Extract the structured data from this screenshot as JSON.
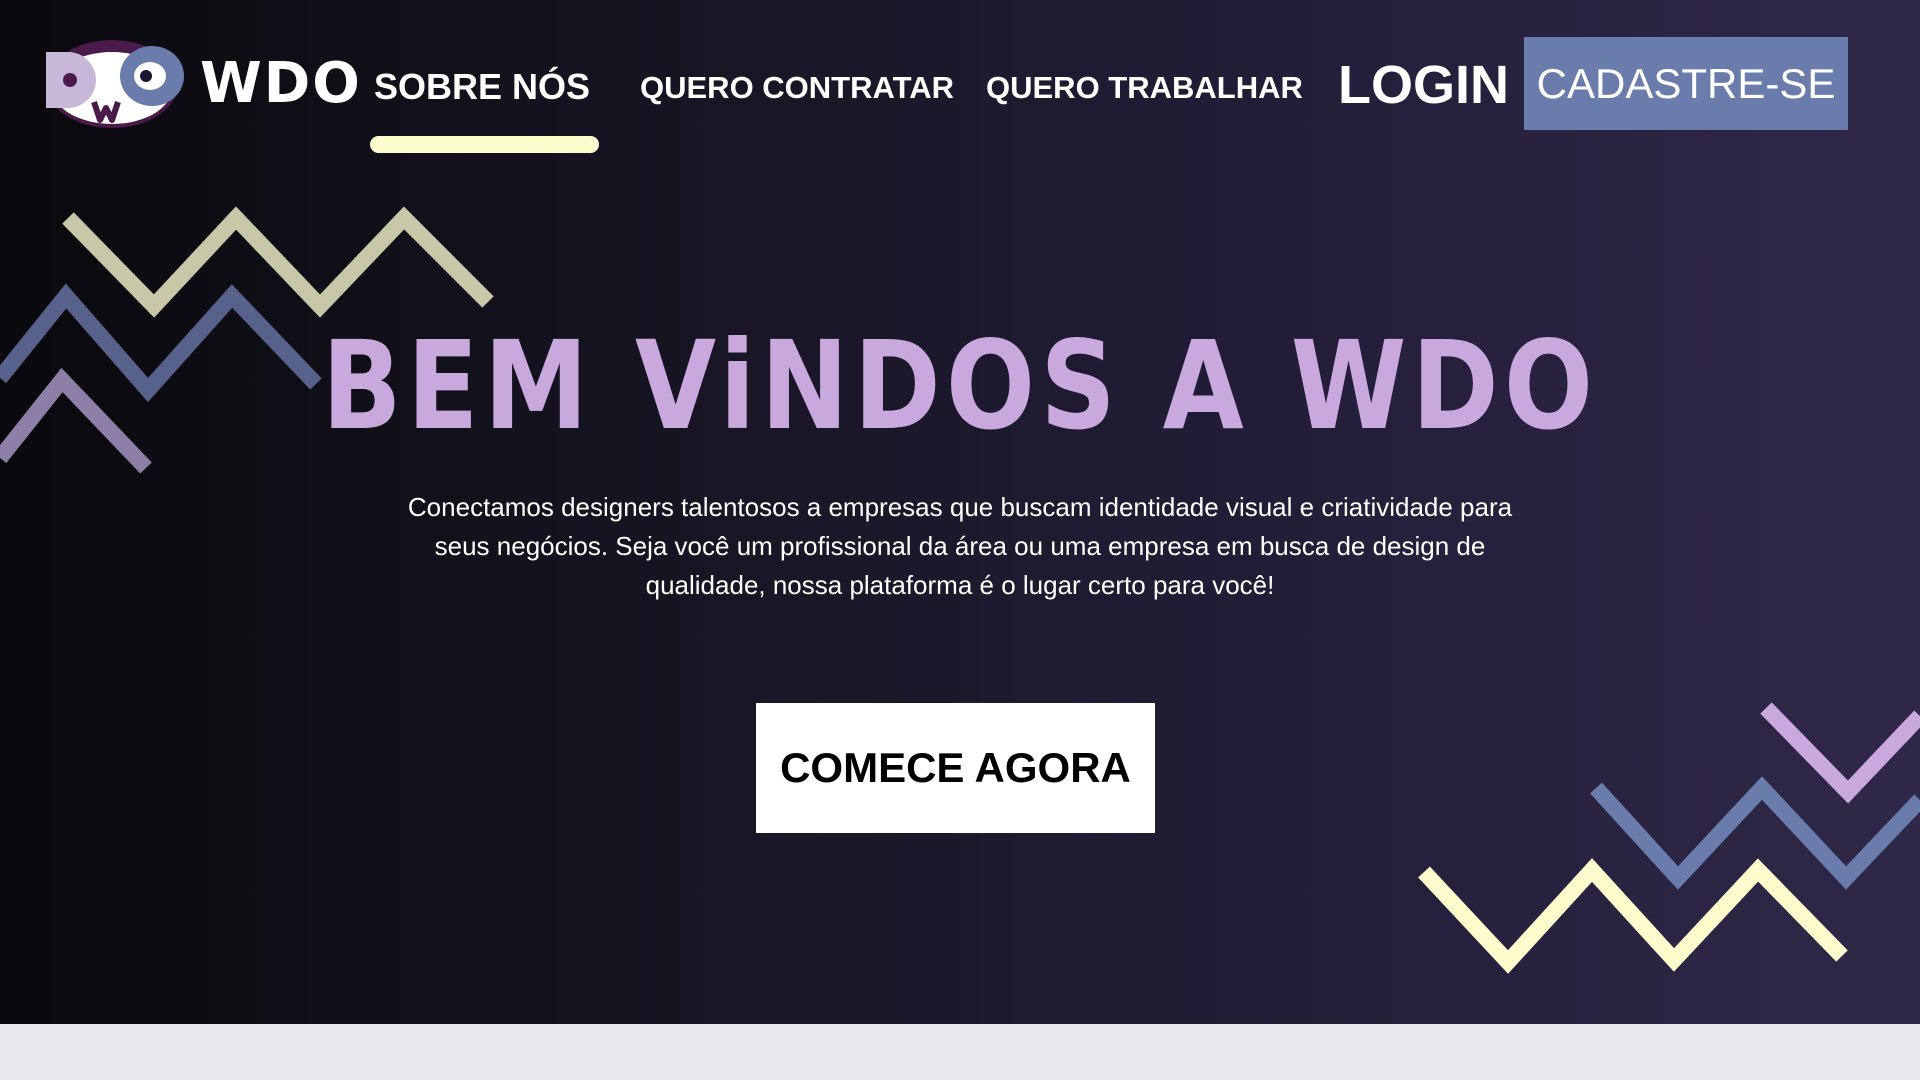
{
  "brand": {
    "name": "WDO",
    "logo_letters": [
      "D",
      "W",
      "O"
    ]
  },
  "nav": {
    "items": [
      {
        "label": "SOBRE NÓS",
        "active": true
      },
      {
        "label": "QUERO CONTRATAR"
      },
      {
        "label": "QUERO TRABALHAR"
      }
    ],
    "login_label": "LOGIN",
    "signup_label": "CADASTRE-SE"
  },
  "hero": {
    "title": "BEM ViNDOS A WDO",
    "description": "Conectamos designers talentosos a empresas que buscam identidade visual e criatividade para seus negócios. Seja você um profissional da área ou uma empresa em busca de design de qualidade, nossa plataforma é o lugar certo para você!",
    "cta_label": "COMECE AGORA"
  },
  "colors": {
    "accent_lilac": "#c8a8dd",
    "accent_blue": "#6a7cab",
    "accent_cream": "#fdfccd",
    "accent_sage": "#c8c8a8",
    "hero_dark": "#0a0a0e",
    "hero_purple": "#302848",
    "footer_gray": "#e6e7eb"
  },
  "icons": {
    "logo": "wdo-face-logo",
    "decor_top_left": "zigzag-lines",
    "decor_bottom_right": "zigzag-lines"
  }
}
